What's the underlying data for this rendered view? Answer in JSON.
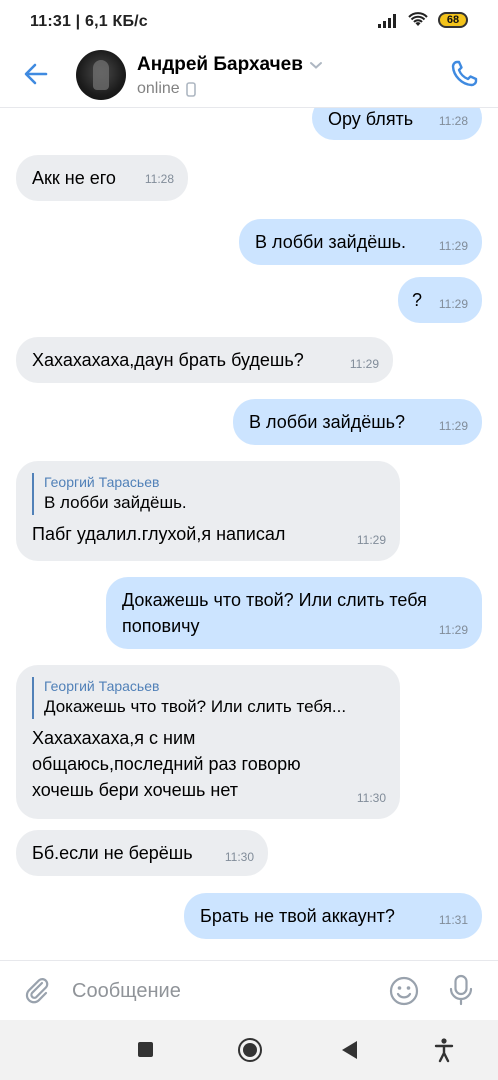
{
  "status_bar": {
    "time_speed": "11:31 | 6,1 КБ/с",
    "battery": "68"
  },
  "header": {
    "contact_name": "Андрей Бархачев",
    "status": "online",
    "back_icon": "arrow-left-icon",
    "call_icon": "phone-icon",
    "accent_color": "#3f8ae0"
  },
  "messages": [
    {
      "direction": "out",
      "text": "Ору блять",
      "time": "11:28"
    },
    {
      "direction": "in",
      "text": "Акк не его",
      "time": "11:28"
    },
    {
      "direction": "out",
      "text": "В лобби зайдёшь.",
      "time": "11:29"
    },
    {
      "direction": "out",
      "text": "?",
      "time": "11:29"
    },
    {
      "direction": "in",
      "text": "Хахахахаха,даун брать будешь?",
      "time": "11:29"
    },
    {
      "direction": "out",
      "text": "В лобби зайдёшь?",
      "time": "11:29"
    },
    {
      "direction": "in",
      "reply_author": "Георгий Тарасьев",
      "reply_text": "В лобби зайдёшь.",
      "text": "Пабг удалил.глухой,я написал",
      "time": "11:29"
    },
    {
      "direction": "out",
      "text_line1": "Докажешь что твой? Или слить тебя",
      "text_line2": "поповичу",
      "time": "11:29"
    },
    {
      "direction": "in",
      "reply_author": "Георгий Тарасьев",
      "reply_text": "Докажешь что твой? Или слить тебя...",
      "text_line1": "Хахахахаха,я с ним",
      "text_line2": "общаюсь,последний раз говорю",
      "text_line3": "хочешь бери хочешь нет",
      "time": "11:30"
    },
    {
      "direction": "in",
      "text": "Бб.если не берёшь",
      "time": "11:30"
    },
    {
      "direction": "out",
      "text": "Брать не твой аккаунт?",
      "time": "11:31"
    }
  ],
  "composer": {
    "placeholder": "Сообщение",
    "value": ""
  },
  "colors": {
    "incoming_bubble": "#ebedf0",
    "outgoing_bubble": "#cce4ff",
    "reply_author": "#5181b8"
  }
}
